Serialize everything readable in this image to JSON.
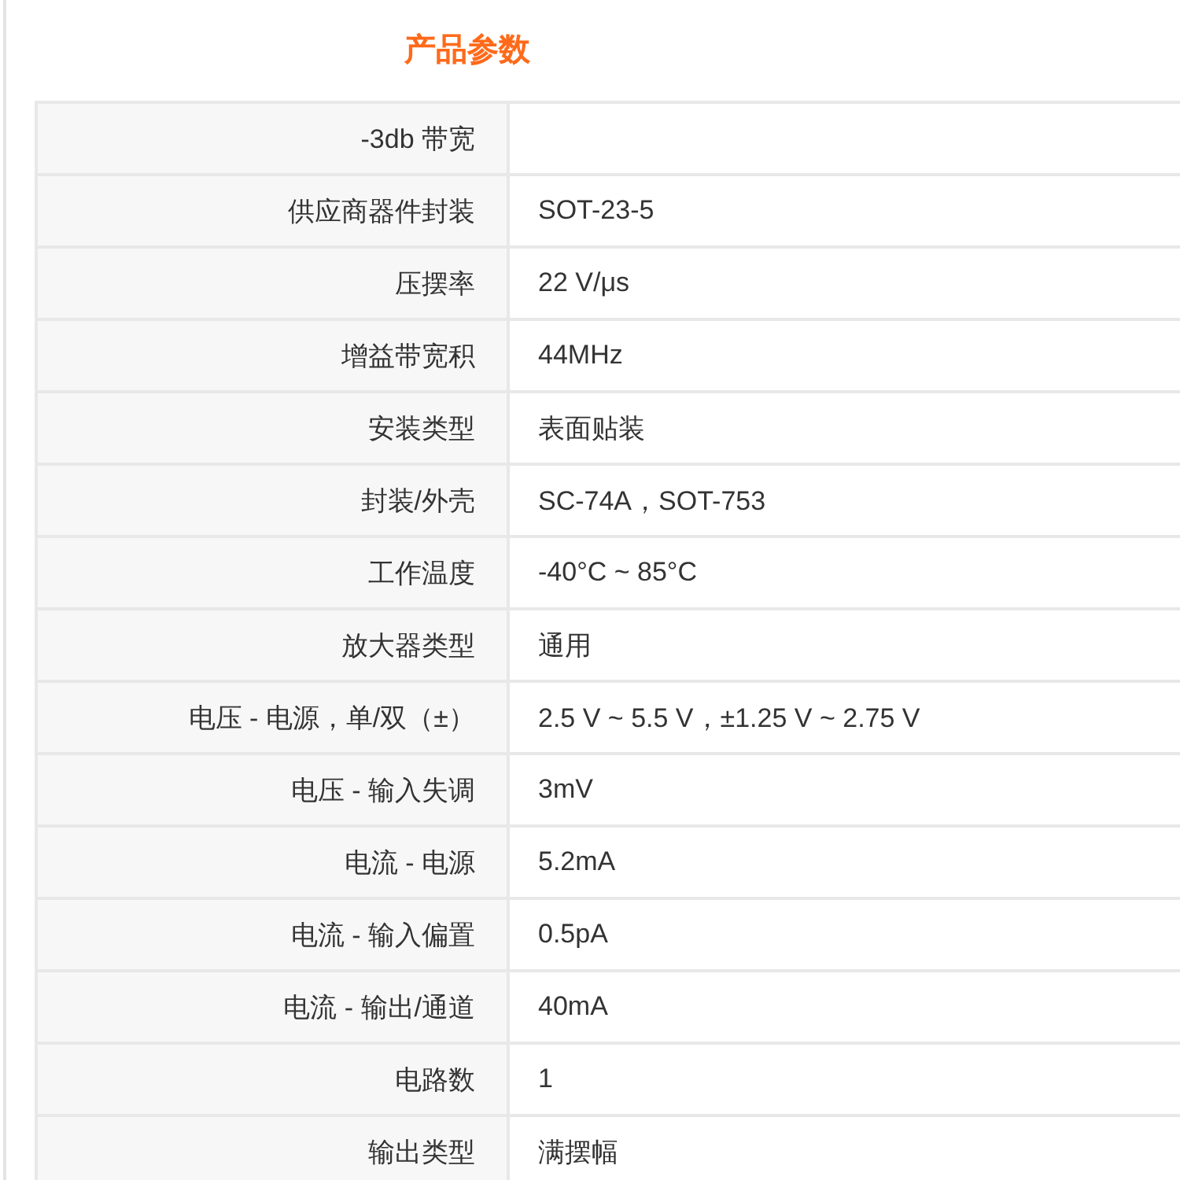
{
  "title": "产品参数",
  "rows": [
    {
      "label": "-3db 带宽"
    },
    {
      "label": "供应商器件封装",
      "value": "SOT-23-5"
    },
    {
      "label": "压摆率",
      "value": "22 V/μs"
    },
    {
      "label": "增益带宽积",
      "value": "44MHz"
    },
    {
      "label": "安装类型",
      "value": "表面贴装"
    },
    {
      "label": "封装/外壳",
      "value": "SC-74A，SOT-753"
    },
    {
      "label": "工作温度",
      "value": "-40°C ~ 85°C"
    },
    {
      "label": "放大器类型",
      "value": "通用"
    },
    {
      "label": "电压 - 电源，单/双（±）",
      "value": "2.5 V ~ 5.5 V，±1.25 V ~ 2.75 V"
    },
    {
      "label": "电压 - 输入失调",
      "value": "3mV"
    },
    {
      "label": "电流 - 电源",
      "value": "5.2mA"
    },
    {
      "label": "电流 - 输入偏置",
      "value": "0.5pA"
    },
    {
      "label": "电流 - 输出/通道",
      "value": "40mA"
    },
    {
      "label": "电路数",
      "value": "1"
    },
    {
      "label": "输出类型",
      "value": "满摆幅"
    }
  ]
}
